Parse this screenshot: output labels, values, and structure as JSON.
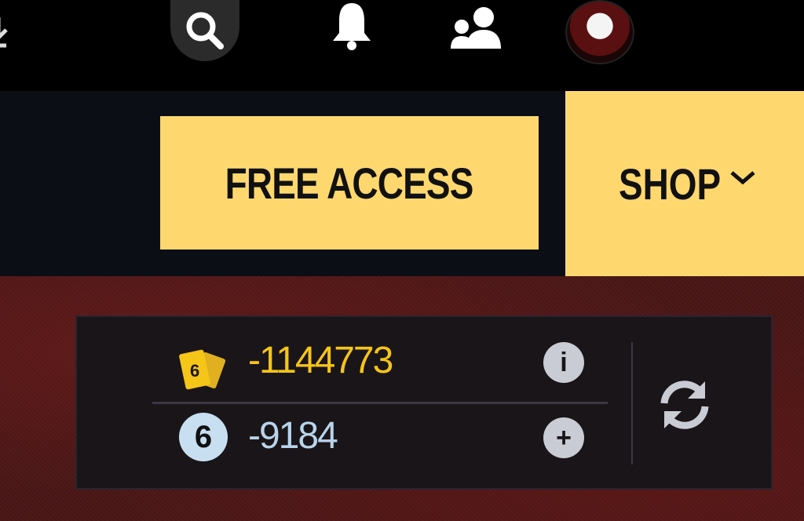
{
  "topbar": {
    "icons": [
      "download-icon",
      "search-icon",
      "bell-icon",
      "friends-icon",
      "avatar"
    ]
  },
  "nav": {
    "free_access_label": "FREE ACCESS",
    "shop_label": "SHOP"
  },
  "wallet": {
    "tickets_value": "-1144773",
    "tickets_icon_text": "6",
    "coins_value": "-9184",
    "coins_icon_text": "6",
    "info_icon_text": "i",
    "add_icon_text": "+"
  },
  "colors": {
    "accent_yellow": "#fed86f",
    "tickets_color": "#f5c518",
    "coins_color": "#b8d4ea",
    "nav_bg": "#0b0e14"
  }
}
